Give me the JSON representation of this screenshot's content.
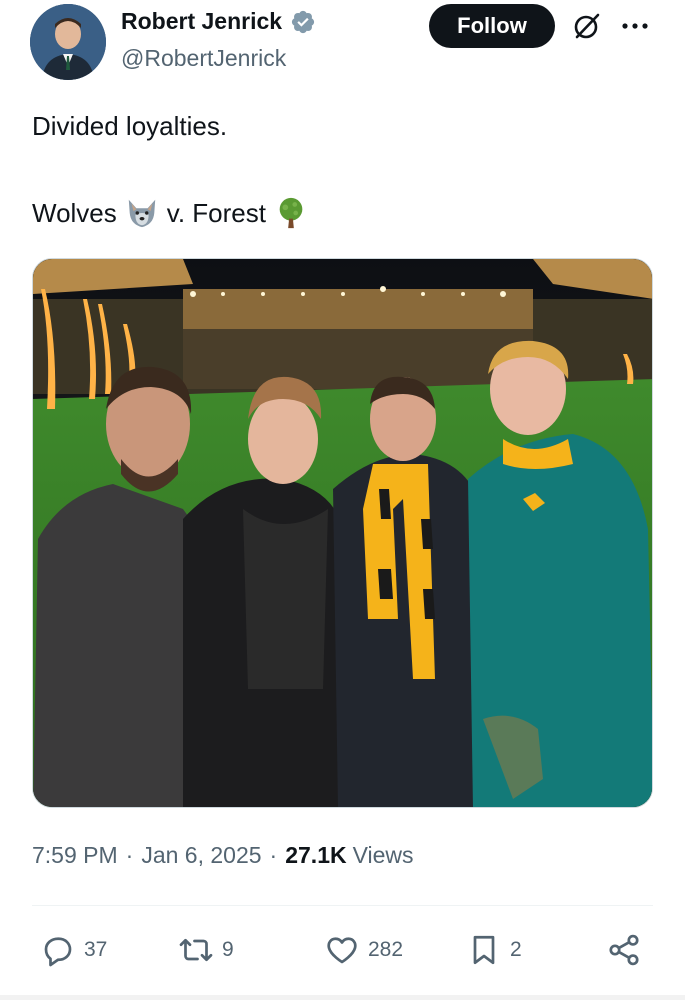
{
  "author": {
    "display_name": "Robert Jenrick",
    "handle": "@RobertJenrick",
    "verified": true
  },
  "header": {
    "follow_label": "Follow",
    "icons": [
      "grok-icon",
      "more-icon"
    ]
  },
  "tweet": {
    "line1": "Divided loyalties.",
    "line2_part1": "Wolves",
    "line2_part2": "v. Forest",
    "emoji1": "wolf-emoji",
    "emoji2": "tree-emoji"
  },
  "meta": {
    "time": "7:59 PM",
    "date": "Jan 6, 2025",
    "views_count": "27.1K",
    "views_label": "Views"
  },
  "actions": {
    "replies": "37",
    "reposts": "9",
    "likes": "282",
    "bookmarks": "2"
  },
  "colors": {
    "text": "#0f1419",
    "secondary": "#536471",
    "verified": "#829aab",
    "follow_bg": "#0f1419"
  }
}
